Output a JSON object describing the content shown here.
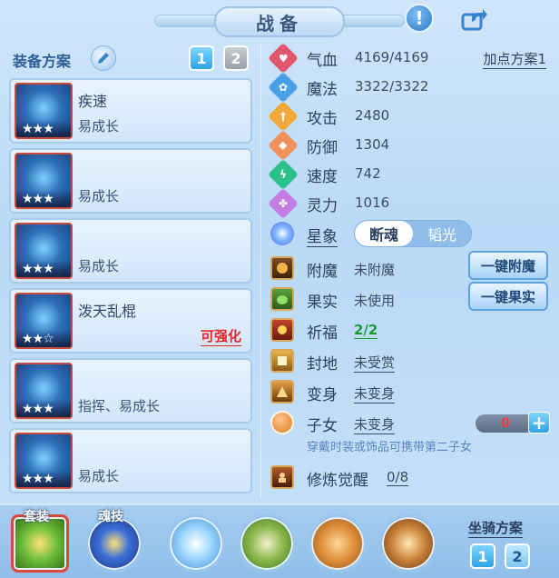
{
  "title": "战备",
  "equipment": {
    "plan_label": "装备方案",
    "plan_buttons": [
      "1",
      "2"
    ],
    "items": [
      {
        "name": "疾速",
        "sub": "易成长",
        "stars": "★★★",
        "tag": ""
      },
      {
        "name": "",
        "sub": "易成长",
        "stars": "★★★",
        "tag": ""
      },
      {
        "name": "",
        "sub": "易成长",
        "stars": "★★★",
        "tag": ""
      },
      {
        "name": "泼天乱棍",
        "sub": "",
        "stars": "★★☆",
        "tag": "可强化"
      },
      {
        "name": "",
        "sub": "指挥、易成长",
        "stars": "★★★",
        "tag": ""
      },
      {
        "name": "",
        "sub": "易成长",
        "stars": "★★★",
        "tag": ""
      }
    ]
  },
  "stats": {
    "point_plan": "加点方案1",
    "rows": [
      {
        "label": "气血",
        "value": "4169/4169",
        "color": "#e2576e",
        "icon": "heart-icon",
        "glyph": "♥"
      },
      {
        "label": "魔法",
        "value": "3322/3322",
        "color": "#4aa0e6",
        "icon": "magic-icon",
        "glyph": "✿"
      },
      {
        "label": "攻击",
        "value": "2480",
        "color": "#f2a83a",
        "icon": "attack-icon",
        "glyph": "†"
      },
      {
        "label": "防御",
        "value": "1304",
        "color": "#f0905a",
        "icon": "defense-icon",
        "glyph": "◆"
      },
      {
        "label": "速度",
        "value": "742",
        "color": "#2bbf8a",
        "icon": "speed-icon",
        "glyph": "ϟ"
      },
      {
        "label": "灵力",
        "value": "1016",
        "color": "#c37ce0",
        "icon": "spirit-icon",
        "glyph": "✤"
      }
    ]
  },
  "star_sign": {
    "label": "星象",
    "options": [
      "断魂",
      "韬光"
    ],
    "selected": "断魂"
  },
  "features": [
    {
      "label": "附魔",
      "value": "未附魔",
      "button": "一键附魔",
      "style": "plain",
      "icon": "enchant-icon"
    },
    {
      "label": "果实",
      "value": "未使用",
      "button": "一键果实",
      "style": "plain",
      "icon": "fruit-icon"
    },
    {
      "label": "祈福",
      "value": "2/2",
      "button": "",
      "style": "green",
      "icon": "blessing-icon"
    },
    {
      "label": "封地",
      "value": "未受赏",
      "button": "",
      "style": "u",
      "icon": "fief-icon"
    },
    {
      "label": "变身",
      "value": "未变身",
      "button": "",
      "style": "u",
      "icon": "transform-icon"
    }
  ],
  "child": {
    "label": "子女",
    "value": "未变身",
    "count": "0",
    "hint": "穿戴时装或饰品可携带第二子女"
  },
  "cultivate": {
    "label": "修炼觉醒",
    "value": "0/8"
  },
  "bottom": {
    "badges": [
      "套装",
      "魂技"
    ],
    "mount_label": "坐骑方案",
    "mount_buttons": [
      "1",
      "2"
    ]
  },
  "colors": {
    "accent": "#2ea2e4",
    "warning": "#e02828",
    "ok": "#1c9a38"
  }
}
